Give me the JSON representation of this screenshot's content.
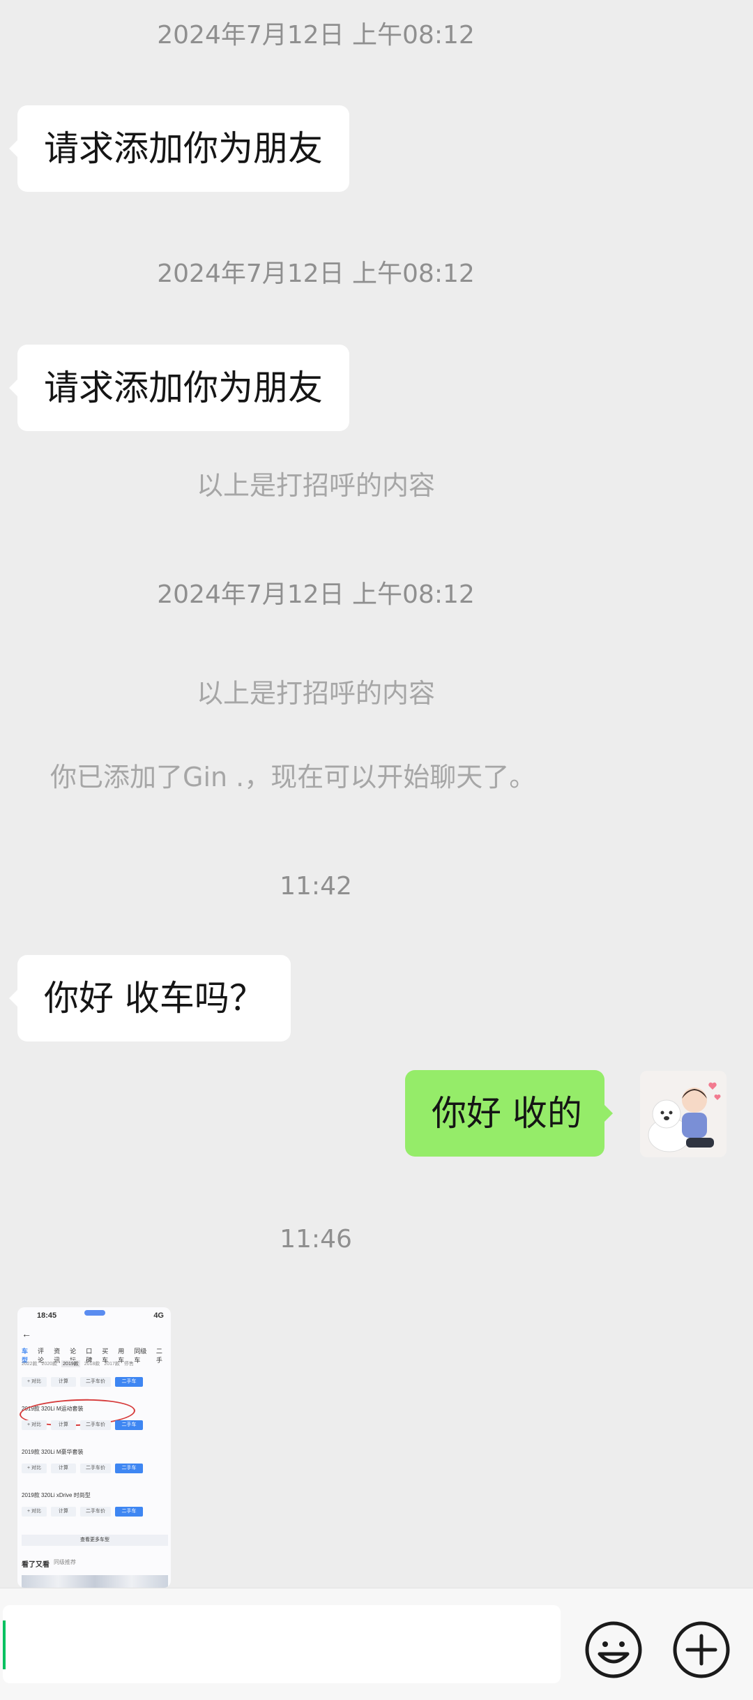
{
  "messages": {
    "ts1": "2024年7月12日 上午08:12",
    "req1": "请求添加你为朋友",
    "ts2": "2024年7月12日 上午08:12",
    "req2": "请求添加你为朋友",
    "greet1": "以上是打招呼的内容",
    "ts3": "2024年7月12日 上午08:12",
    "greet2": "以上是打招呼的内容",
    "added": "你已添加了Gin .，现在可以开始聊天了。",
    "ts4": "11:42",
    "msg_in": "你好 收车吗？",
    "msg_out": "你好 收的",
    "ts5": "11:46"
  },
  "screenshot": {
    "time": "18:45",
    "status": "4G",
    "nav": [
      "车型",
      "评论",
      "资讯",
      "论坛",
      "口碑",
      "买车",
      "用车",
      "同级车",
      "二手"
    ],
    "years": [
      "2022款",
      "2020款",
      "2019款",
      "2018款",
      "2017款",
      "停售"
    ],
    "variants": [
      "2019款 320Li M运动套装",
      "2019款 320Li M豪华套装",
      "2019款 320Li xDrive 时尚型"
    ],
    "btn_compare": "+ 对比",
    "btn_calc": "计算",
    "btn_used_price": "二手车价",
    "btn_used": "二手车",
    "more": "查看更多车型",
    "footer": "看了又看",
    "footer2": "同级推荐"
  },
  "input": {
    "emoji_icon": "smiley-face-icon",
    "plus_icon": "plus-circle-icon"
  }
}
